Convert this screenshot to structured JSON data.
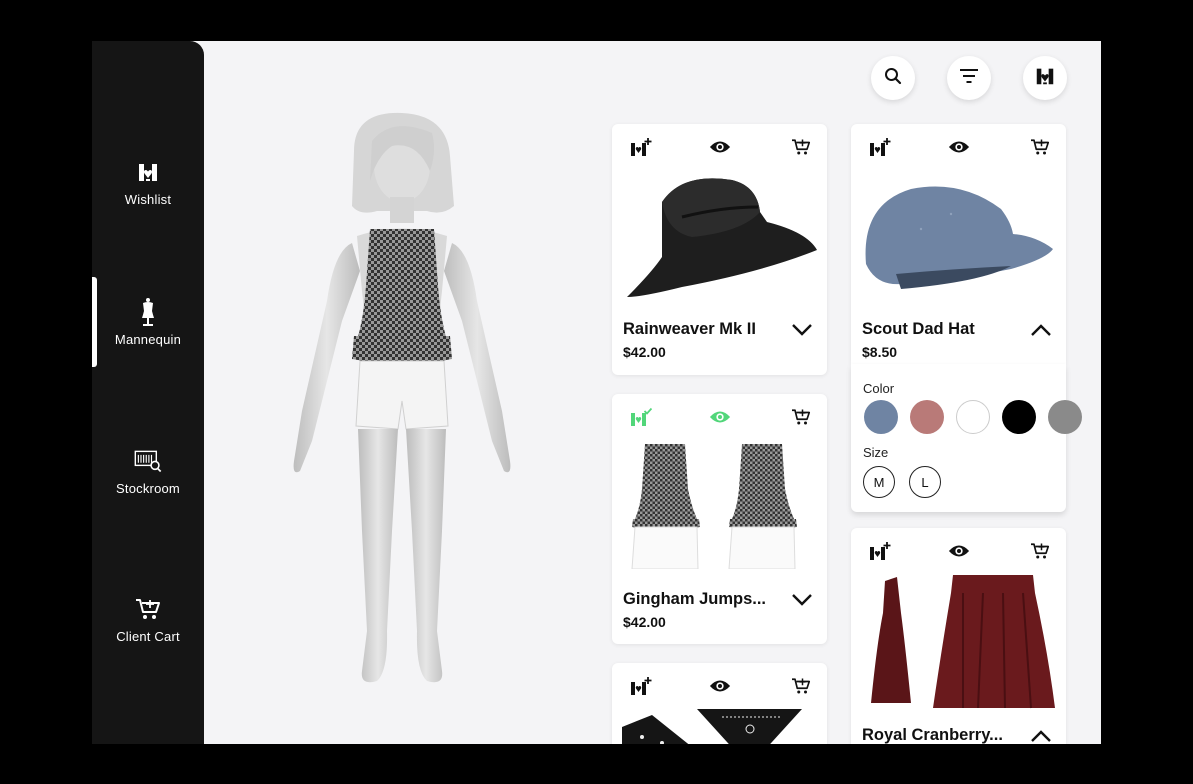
{
  "sidebar": {
    "items": [
      {
        "label": "Wishlist",
        "icon": "wishlist-icon"
      },
      {
        "label": "Mannequin",
        "icon": "mannequin-icon",
        "active": true
      },
      {
        "label": "Stockroom",
        "icon": "stockroom-icon"
      },
      {
        "label": "Client Cart",
        "icon": "cart-icon"
      }
    ]
  },
  "toolbar": {
    "icons": [
      "search-icon",
      "filter-icon",
      "wishlist-icon"
    ]
  },
  "products": [
    {
      "name": "Rainweaver Mk II",
      "price": "$42.00",
      "expanded": false
    },
    {
      "name": "Gingham Jumps...",
      "price": "$42.00",
      "expanded": false,
      "in_wishlist": true,
      "viewing": true
    },
    {
      "name": "Scout Dad Hat",
      "price": "$8.50",
      "expanded": true
    },
    {
      "name": "Royal Cranberry...",
      "price": "",
      "expanded": true
    }
  ],
  "options": {
    "color_label": "Color",
    "colors": [
      "#6f84a3",
      "#b97a78",
      "#ffffff",
      "#000000",
      "#8a8a8a"
    ],
    "size_label": "Size",
    "sizes": [
      "M",
      "L"
    ]
  },
  "colors": {
    "sidebar": "#151515",
    "background": "#f4f4f6",
    "accent_green": "#52d67a"
  }
}
